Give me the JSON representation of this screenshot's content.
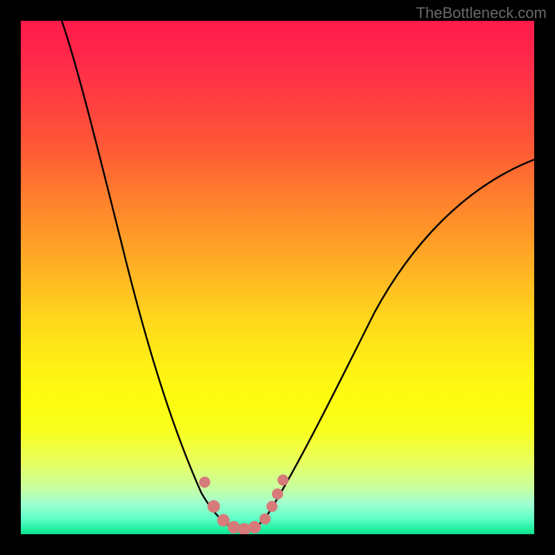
{
  "watermark": "TheBottleneck.com",
  "chart_data": {
    "type": "line",
    "title": "",
    "xlabel": "",
    "ylabel": "",
    "xlim": [
      0,
      100
    ],
    "ylim": [
      0,
      100
    ],
    "description": "Bottleneck curve on rainbow gradient background (red top = high bottleneck, green bottom = low). Black V-shaped curve with minimum near x≈43 at y≈0. Pink dotted markers near the trough.",
    "series": [
      {
        "name": "bottleneck-curve",
        "color": "#000000",
        "x": [
          8,
          12,
          16,
          20,
          24,
          28,
          32,
          34,
          36,
          38,
          40,
          42,
          43,
          44,
          46,
          48,
          52,
          56,
          60,
          66,
          72,
          80,
          90,
          100
        ],
        "y": [
          100,
          85,
          70,
          56,
          43,
          31,
          20,
          15,
          11,
          7,
          4,
          2,
          1,
          1.5,
          3,
          5,
          10,
          16,
          22,
          31,
          40,
          50,
          60,
          68
        ]
      }
    ],
    "trough_markers": {
      "color": "#d67a7a",
      "points": [
        {
          "x": 36,
          "y": 11
        },
        {
          "x": 38,
          "y": 4
        },
        {
          "x": 40,
          "y": 2
        },
        {
          "x": 42,
          "y": 1.5
        },
        {
          "x": 44,
          "y": 1.5
        },
        {
          "x": 46,
          "y": 2
        },
        {
          "x": 48,
          "y": 4
        },
        {
          "x": 49,
          "y": 6
        },
        {
          "x": 50,
          "y": 8
        },
        {
          "x": 51,
          "y": 11
        }
      ]
    },
    "gradient_stops": [
      {
        "pos": 0,
        "color": "#ff1a4a"
      },
      {
        "pos": 50,
        "color": "#ffd61c"
      },
      {
        "pos": 80,
        "color": "#f8ff20"
      },
      {
        "pos": 100,
        "color": "#10e090"
      }
    ]
  }
}
